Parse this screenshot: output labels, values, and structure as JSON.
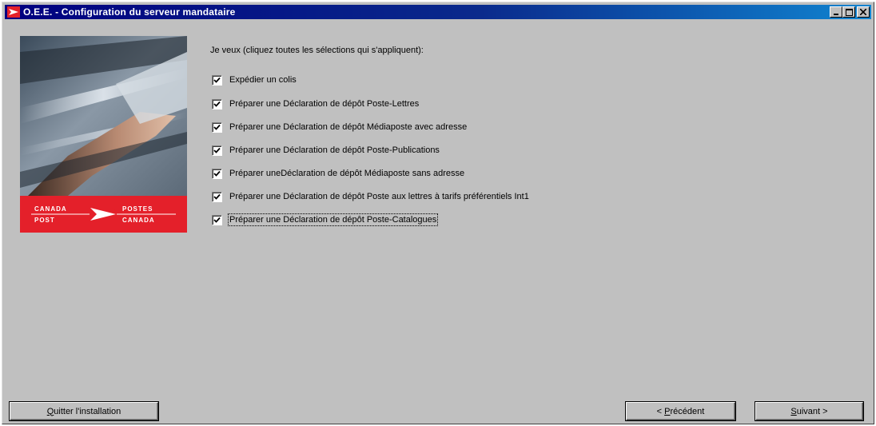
{
  "window": {
    "title": "O.E.E. - Configuration du serveur mandataire"
  },
  "colors": {
    "titlebar_start": "#000080",
    "titlebar_end": "#1084d0",
    "canada_post_red": "#e4202a",
    "dialog_bg": "#c0c0c0"
  },
  "sidebar": {
    "logo_text": {
      "top_left": "CANADA",
      "top_right": "POSTES",
      "bottom_left": "POST",
      "bottom_right": "CANADA"
    }
  },
  "main": {
    "prompt": "Je veux (cliquez toutes les sélections qui s'appliquent):",
    "options": [
      {
        "label": "Expédier un colis",
        "checked": true
      },
      {
        "label": "Préparer une Déclaration de dépôt Poste-Lettres",
        "checked": true
      },
      {
        "label": "Préparer une Déclaration de dépôt Médiaposte avec adresse",
        "checked": true
      },
      {
        "label": "Préparer une Déclaration de dépôt Poste-Publications",
        "checked": true
      },
      {
        "label": "Préparer uneDéclaration de dépôt Médiaposte sans adresse",
        "checked": true
      },
      {
        "label": "Préparer une Déclaration de dépôt Poste aux lettres à tarifs préférentiels Int1",
        "checked": true
      },
      {
        "label": "Préparer une Déclaration de dépôt Poste-Catalogues",
        "checked": true,
        "focused": true
      }
    ]
  },
  "buttons": {
    "quit": {
      "label": "Quitter l'installation",
      "mnemonic": "Q"
    },
    "previous": {
      "label": "< Précédent",
      "mnemonic": "P"
    },
    "next": {
      "label": "Suivant >",
      "mnemonic": "S"
    }
  }
}
